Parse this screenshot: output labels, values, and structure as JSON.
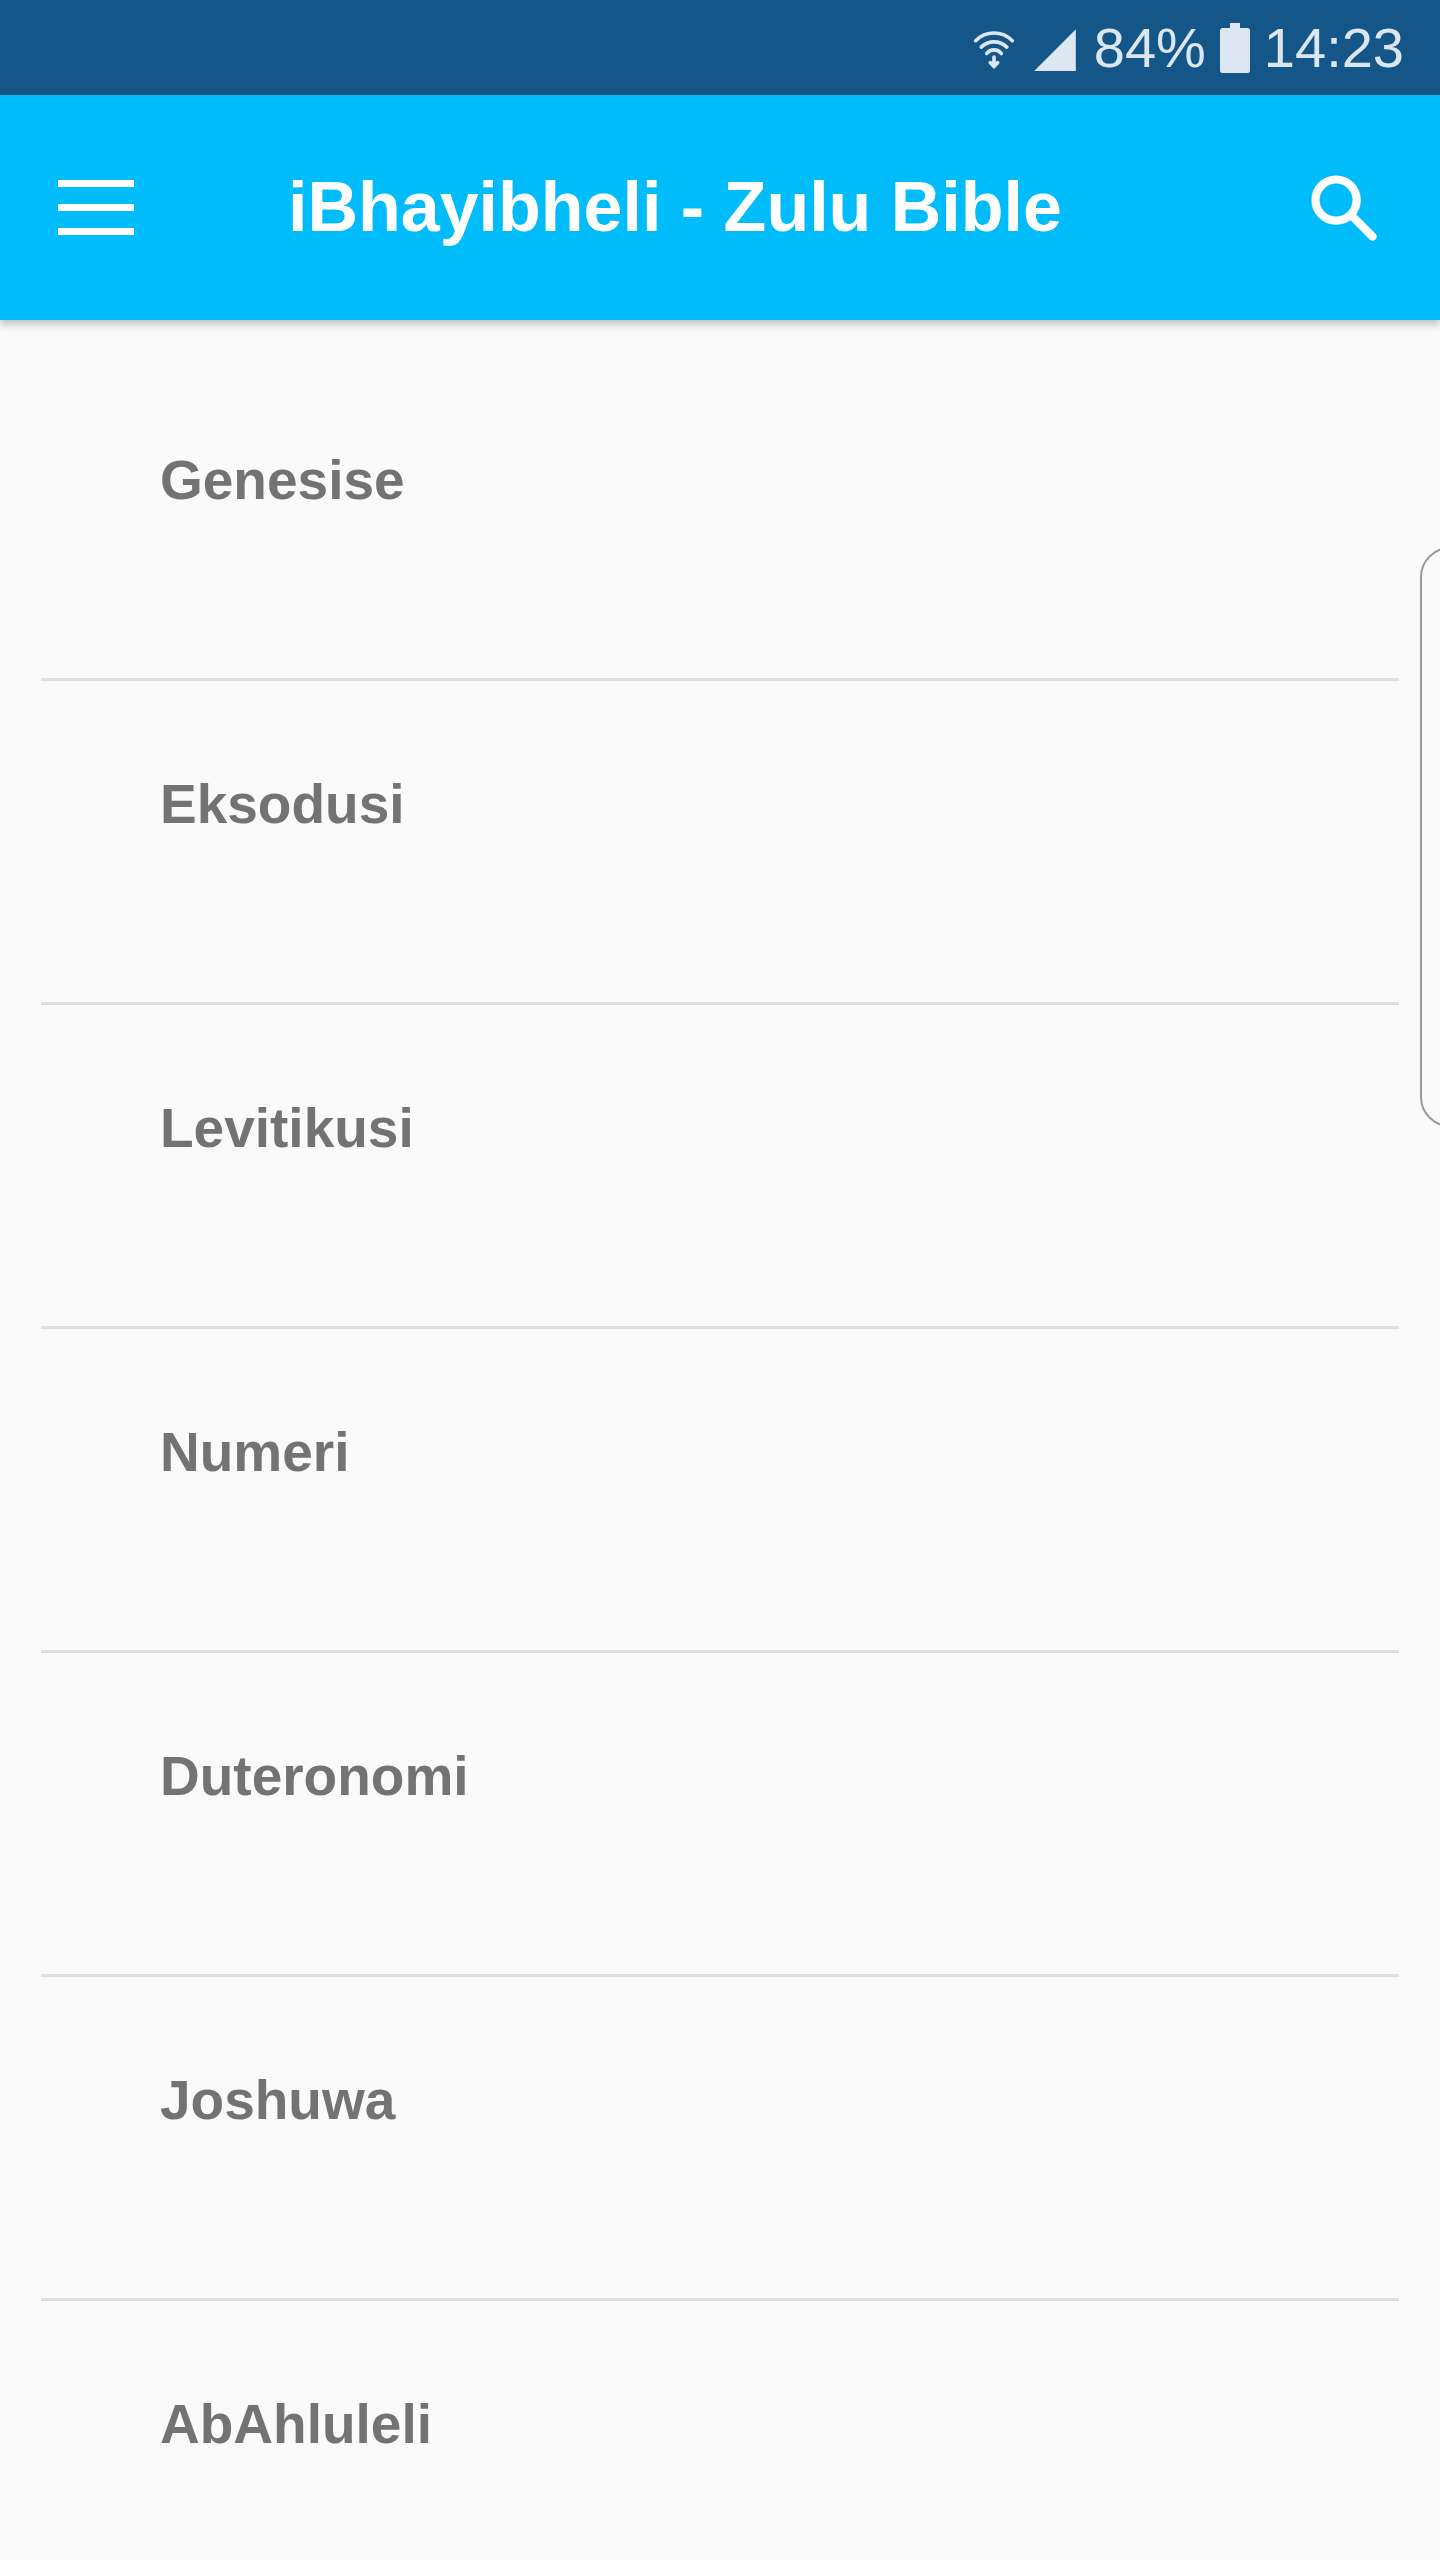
{
  "status_bar": {
    "battery": "84%",
    "time": "14:23"
  },
  "app_bar": {
    "title": "iBhayibheli - Zulu Bible"
  },
  "books": [
    {
      "name": "Genesise"
    },
    {
      "name": "Eksodusi"
    },
    {
      "name": "Levitikusi"
    },
    {
      "name": "Numeri"
    },
    {
      "name": "Duteronomi"
    },
    {
      "name": "Joshuwa"
    },
    {
      "name": "AbAhluleli"
    }
  ]
}
